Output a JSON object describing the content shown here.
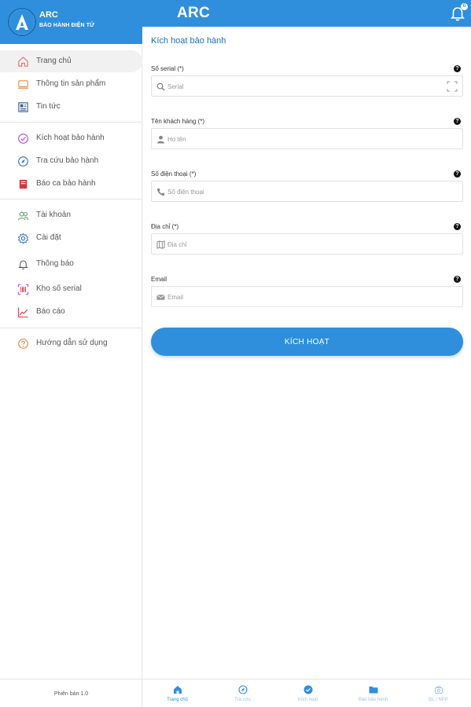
{
  "brand": {
    "name": "ARC",
    "subtitle": "BẢO HÀNH ĐIỆN TỬ"
  },
  "menu": {
    "items": [
      {
        "label": "Trang chủ",
        "icon": "home-icon",
        "active": true
      },
      {
        "label": "Thông tin sản phẩm",
        "icon": "laptop-icon"
      },
      {
        "label": "Tin tức",
        "icon": "news-icon"
      },
      {
        "label": "Kích hoạt bảo hành",
        "icon": "check-circle-icon"
      },
      {
        "label": "Tra cứu bảo hành",
        "icon": "compass-icon"
      },
      {
        "label": "Báo ca bảo hành",
        "icon": "report-icon"
      },
      {
        "label": "Tài khoản",
        "icon": "users-icon"
      },
      {
        "label": "Cài đặt",
        "icon": "gear-icon"
      },
      {
        "label": "Thông báo",
        "icon": "bell-icon"
      },
      {
        "label": "Kho số serial",
        "icon": "barcode-icon"
      },
      {
        "label": "Báo cáo",
        "icon": "chart-icon"
      },
      {
        "label": "Hướng dẫn sử dụng",
        "icon": "help-icon"
      }
    ],
    "version": "Phiên bản 1.0"
  },
  "topbar": {
    "title": "ARC",
    "notification_count": "0"
  },
  "form": {
    "title": "Kích hoạt bảo hành",
    "fields": [
      {
        "label": "Số serial (*)",
        "placeholder": "Serial",
        "icon": "search-icon"
      },
      {
        "label": "Tên khách hàng (*)",
        "placeholder": "Họ tên",
        "icon": "person-icon"
      },
      {
        "label": "Số điện thoại (*)",
        "placeholder": "Số điện thoại",
        "icon": "phone-icon"
      },
      {
        "label": "Địa chỉ (*)",
        "placeholder": "Địa chỉ",
        "icon": "map-icon"
      },
      {
        "label": "Email",
        "placeholder": "Email",
        "icon": "email-icon"
      }
    ],
    "help_glyph": "?",
    "submit_label": "KÍCH HOẠT"
  },
  "tabs": [
    {
      "label": "Trang chủ",
      "icon": "home-icon"
    },
    {
      "label": "Tra cứu",
      "icon": "compass-icon"
    },
    {
      "label": "Kích hoạt",
      "icon": "check-circle-icon"
    },
    {
      "label": "Báo bảo hành",
      "icon": "folder-icon"
    },
    {
      "label": "ĐL / NPP",
      "icon": "store-icon"
    }
  ],
  "colors": {
    "primary": "#2f8fdc",
    "title_blue": "#1e6fc1"
  }
}
